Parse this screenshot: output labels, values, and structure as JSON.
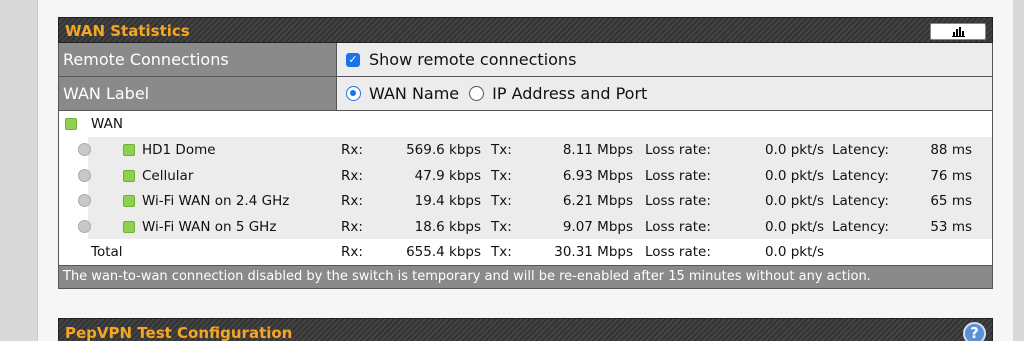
{
  "wan_panel": {
    "title": "WAN Statistics",
    "chart_button_icon": "bar-chart-icon",
    "remote_connections": {
      "label": "Remote Connections",
      "checkbox_label": "Show remote connections",
      "checked": true
    },
    "wan_label": {
      "label": "WAN Label",
      "options": [
        "WAN Name",
        "IP Address and Port"
      ],
      "selected": "WAN Name"
    },
    "group": {
      "name": "WAN"
    },
    "connections": [
      {
        "name": "HD1 Dome",
        "rx_label": "Rx:",
        "rx": "569.6 kbps",
        "tx_label": "Tx:",
        "tx": "8.11 Mbps",
        "loss_label": "Loss rate:",
        "loss": "0.0 pkt/s",
        "latency_label": "Latency:",
        "latency": "88 ms"
      },
      {
        "name": "Cellular",
        "rx_label": "Rx:",
        "rx": "47.9 kbps",
        "tx_label": "Tx:",
        "tx": "6.93 Mbps",
        "loss_label": "Loss rate:",
        "loss": "0.0 pkt/s",
        "latency_label": "Latency:",
        "latency": "76 ms"
      },
      {
        "name": "Wi-Fi WAN on 2.4 GHz",
        "rx_label": "Rx:",
        "rx": "19.4 kbps",
        "tx_label": "Tx:",
        "tx": "6.21 Mbps",
        "loss_label": "Loss rate:",
        "loss": "0.0 pkt/s",
        "latency_label": "Latency:",
        "latency": "65 ms"
      },
      {
        "name": "Wi-Fi WAN on 5 GHz",
        "rx_label": "Rx:",
        "rx": "18.6 kbps",
        "tx_label": "Tx:",
        "tx": "9.07 Mbps",
        "loss_label": "Loss rate:",
        "loss": "0.0 pkt/s",
        "latency_label": "Latency:",
        "latency": "53 ms"
      }
    ],
    "total": {
      "name": "Total",
      "rx_label": "Rx:",
      "rx": "655.4 kbps",
      "tx_label": "Tx:",
      "tx": "30.31 Mbps",
      "loss_label": "Loss rate:",
      "loss": "0.0 pkt/s"
    },
    "note": "The wan-to-wan connection disabled by the switch is temporary and will be re-enabled after 15 minutes without any action."
  },
  "pepvpn_panel": {
    "title": "PepVPN Test Configuration",
    "help_icon": "help-icon",
    "help_text": "?"
  },
  "colors": {
    "title_orange": "#f5a623",
    "status_green": "#8fd14f",
    "toggle_blue": "#3d7fd1",
    "header_dark": "#333333"
  }
}
